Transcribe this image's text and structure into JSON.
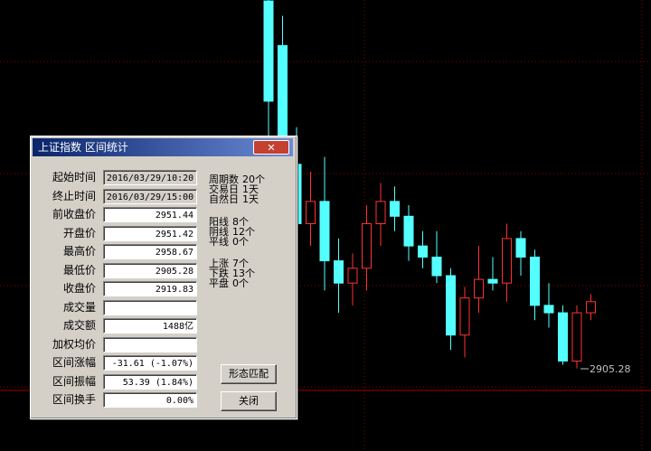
{
  "window": {
    "title": "上证指数 区间统计",
    "close_label": "✕"
  },
  "fields": [
    {
      "label": "起始时间",
      "value": "2016/03/29/10:20"
    },
    {
      "label": "终止时间",
      "value": "2016/03/29/15:00"
    },
    {
      "label": "前收盘价",
      "value": "2951.44"
    },
    {
      "label": "开盘价",
      "value": "2951.42"
    },
    {
      "label": "最高价",
      "value": "2958.67"
    },
    {
      "label": "最低价",
      "value": "2905.28"
    },
    {
      "label": "收盘价",
      "value": "2919.83"
    },
    {
      "label": "成交量",
      "value": ""
    },
    {
      "label": "成交额",
      "value": "1488亿"
    },
    {
      "label": "加权均价",
      "value": ""
    },
    {
      "label": "区间涨幅",
      "value": "-31.61 (-1.07%)"
    },
    {
      "label": "区间振幅",
      "value": "53.39 (1.84%)"
    },
    {
      "label": "区间换手",
      "value": "0.00%"
    }
  ],
  "stats": {
    "period_count": {
      "label": "周期数",
      "value": "20个"
    },
    "trade_days": {
      "label": "交易日",
      "value": "1天"
    },
    "natural_days": {
      "label": "自然日",
      "value": "1天"
    },
    "yang": {
      "label": "阳线",
      "value": "8个"
    },
    "yin": {
      "label": "阴线",
      "value": "12个"
    },
    "flat_line": {
      "label": "平线",
      "value": "0个"
    },
    "up": {
      "label": "上涨",
      "value": "7个"
    },
    "down": {
      "label": "下跌",
      "value": "13个"
    },
    "flat": {
      "label": "平盘",
      "value": "0个"
    }
  },
  "buttons": {
    "pattern_match": "形态匹配",
    "close": "关闭"
  },
  "chart": {
    "low_marker": "2905.28",
    "colors": {
      "up": "#ff3232",
      "down": "#54ffff",
      "grid": "#8b0000",
      "border": "#a00000"
    }
  },
  "chart_data": {
    "type": "candlestick",
    "y_unit": "index points",
    "candles": [
      {
        "o": 1002,
        "c": 975,
        "h": 1010,
        "l": 960
      },
      {
        "o": 990,
        "c": 955,
        "h": 998,
        "l": 945
      },
      {
        "o": 958,
        "c": 942,
        "h": 968,
        "l": 930
      },
      {
        "o": 942,
        "c": 948,
        "h": 956,
        "l": 936
      },
      {
        "o": 948,
        "c": 932,
        "h": 960,
        "l": 924
      },
      {
        "o": 932,
        "c": 926,
        "h": 938,
        "l": 918
      },
      {
        "o": 926,
        "c": 930,
        "h": 934,
        "l": 920
      },
      {
        "o": 930,
        "c": 942,
        "h": 947,
        "l": 924
      },
      {
        "o": 942,
        "c": 948,
        "h": 953,
        "l": 936
      },
      {
        "o": 948,
        "c": 944,
        "h": 952,
        "l": 940
      },
      {
        "o": 944,
        "c": 936,
        "h": 947,
        "l": 932
      },
      {
        "o": 936,
        "c": 933,
        "h": 940,
        "l": 930
      },
      {
        "o": 933,
        "c": 928,
        "h": 940,
        "l": 926
      },
      {
        "o": 928,
        "c": 912,
        "h": 930,
        "l": 908
      },
      {
        "o": 912,
        "c": 922,
        "h": 925,
        "l": 906
      },
      {
        "o": 922,
        "c": 927,
        "h": 936,
        "l": 918
      },
      {
        "o": 927,
        "c": 926,
        "h": 933,
        "l": 924
      },
      {
        "o": 926,
        "c": 938,
        "h": 942,
        "l": 921
      },
      {
        "o": 938,
        "c": 933,
        "h": 940,
        "l": 928
      },
      {
        "o": 933,
        "c": 920,
        "h": 935,
        "l": 916
      },
      {
        "o": 920,
        "c": 918,
        "h": 926,
        "l": 914
      },
      {
        "o": 918,
        "c": 905,
        "h": 920,
        "l": 904
      },
      {
        "o": 905,
        "c": 918,
        "h": 920,
        "l": 903
      },
      {
        "o": 918,
        "c": 921,
        "h": 923,
        "l": 916
      }
    ]
  }
}
